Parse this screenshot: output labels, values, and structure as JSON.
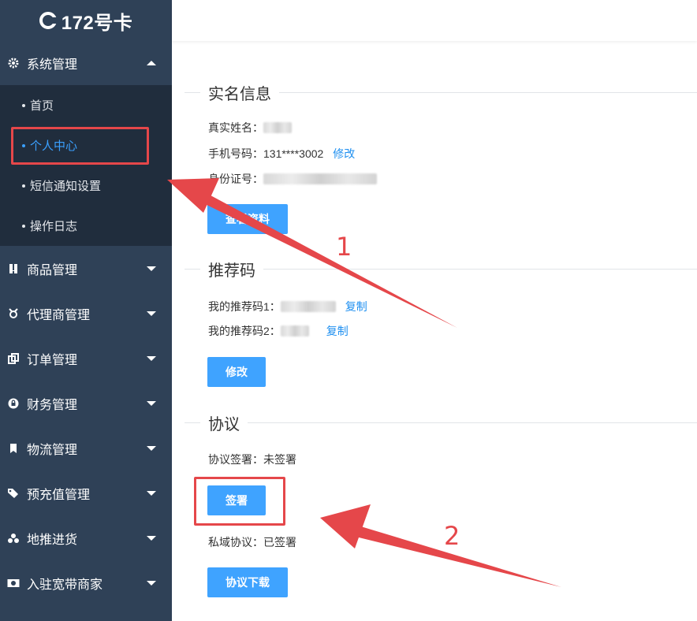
{
  "app": {
    "logo_text": "172号卡"
  },
  "sidebar": {
    "system": {
      "label": "系统管理",
      "items": [
        {
          "label": "首页"
        },
        {
          "label": "个人中心",
          "active": true
        },
        {
          "label": "短信通知设置"
        },
        {
          "label": "操作日志"
        }
      ]
    },
    "groups": [
      {
        "label": "商品管理",
        "icon": "product-icon"
      },
      {
        "label": "代理商管理",
        "icon": "agent-icon"
      },
      {
        "label": "订单管理",
        "icon": "order-icon"
      },
      {
        "label": "财务管理",
        "icon": "lock-icon"
      },
      {
        "label": "物流管理",
        "icon": "bookmark-icon"
      },
      {
        "label": "预充值管理",
        "icon": "tag-icon"
      },
      {
        "label": "地推进货",
        "icon": "coins-icon"
      },
      {
        "label": "入驻宽带商家",
        "icon": "money-icon"
      }
    ]
  },
  "realname": {
    "title": "实名信息",
    "name_label": "真实姓名：",
    "phone_label": "手机号码：",
    "phone_value": "131****3002",
    "phone_edit": "修改",
    "id_label": "身份证号：",
    "view_button": "查看资料"
  },
  "referral": {
    "title": "推荐码",
    "code1_label": "我的推荐码1：",
    "code1_copy": "复制",
    "code2_label": "我的推荐码2：",
    "code2_copy": "复制",
    "edit_button": "修改"
  },
  "agreement": {
    "title": "协议",
    "sign_label": "协议签署：",
    "sign_status": "未签署",
    "sign_button": "签署",
    "private_label": "私域协议：",
    "private_status": "已签署",
    "download_button": "协议下载"
  },
  "annotations": {
    "num1": "1",
    "num2": "2"
  },
  "colors": {
    "sidebar": "#2f4157",
    "submenu": "#202d3d",
    "accent": "#3fa3ff",
    "annotation": "#e5474a"
  }
}
